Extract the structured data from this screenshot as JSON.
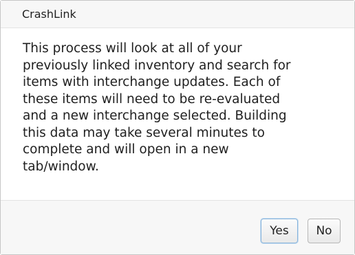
{
  "dialog": {
    "title": "CrashLink",
    "message_lines": [
      "This process will look at all of your",
      "previously linked inventory and search for",
      "items with interchange updates. Each of",
      "these items will need to be re-evaluated",
      "and a new interchange selected. Building",
      "this data may take several minutes to",
      "complete and will open in a new",
      "tab/window."
    ],
    "buttons": {
      "yes_label": "Yes",
      "no_label": "No"
    }
  },
  "colors": {
    "titlebar_bg": "#f7f7f7",
    "footer_bg": "#f7f7f7",
    "dialog_border": "#c6c6c6",
    "focused_button_border": "#86b3db"
  }
}
